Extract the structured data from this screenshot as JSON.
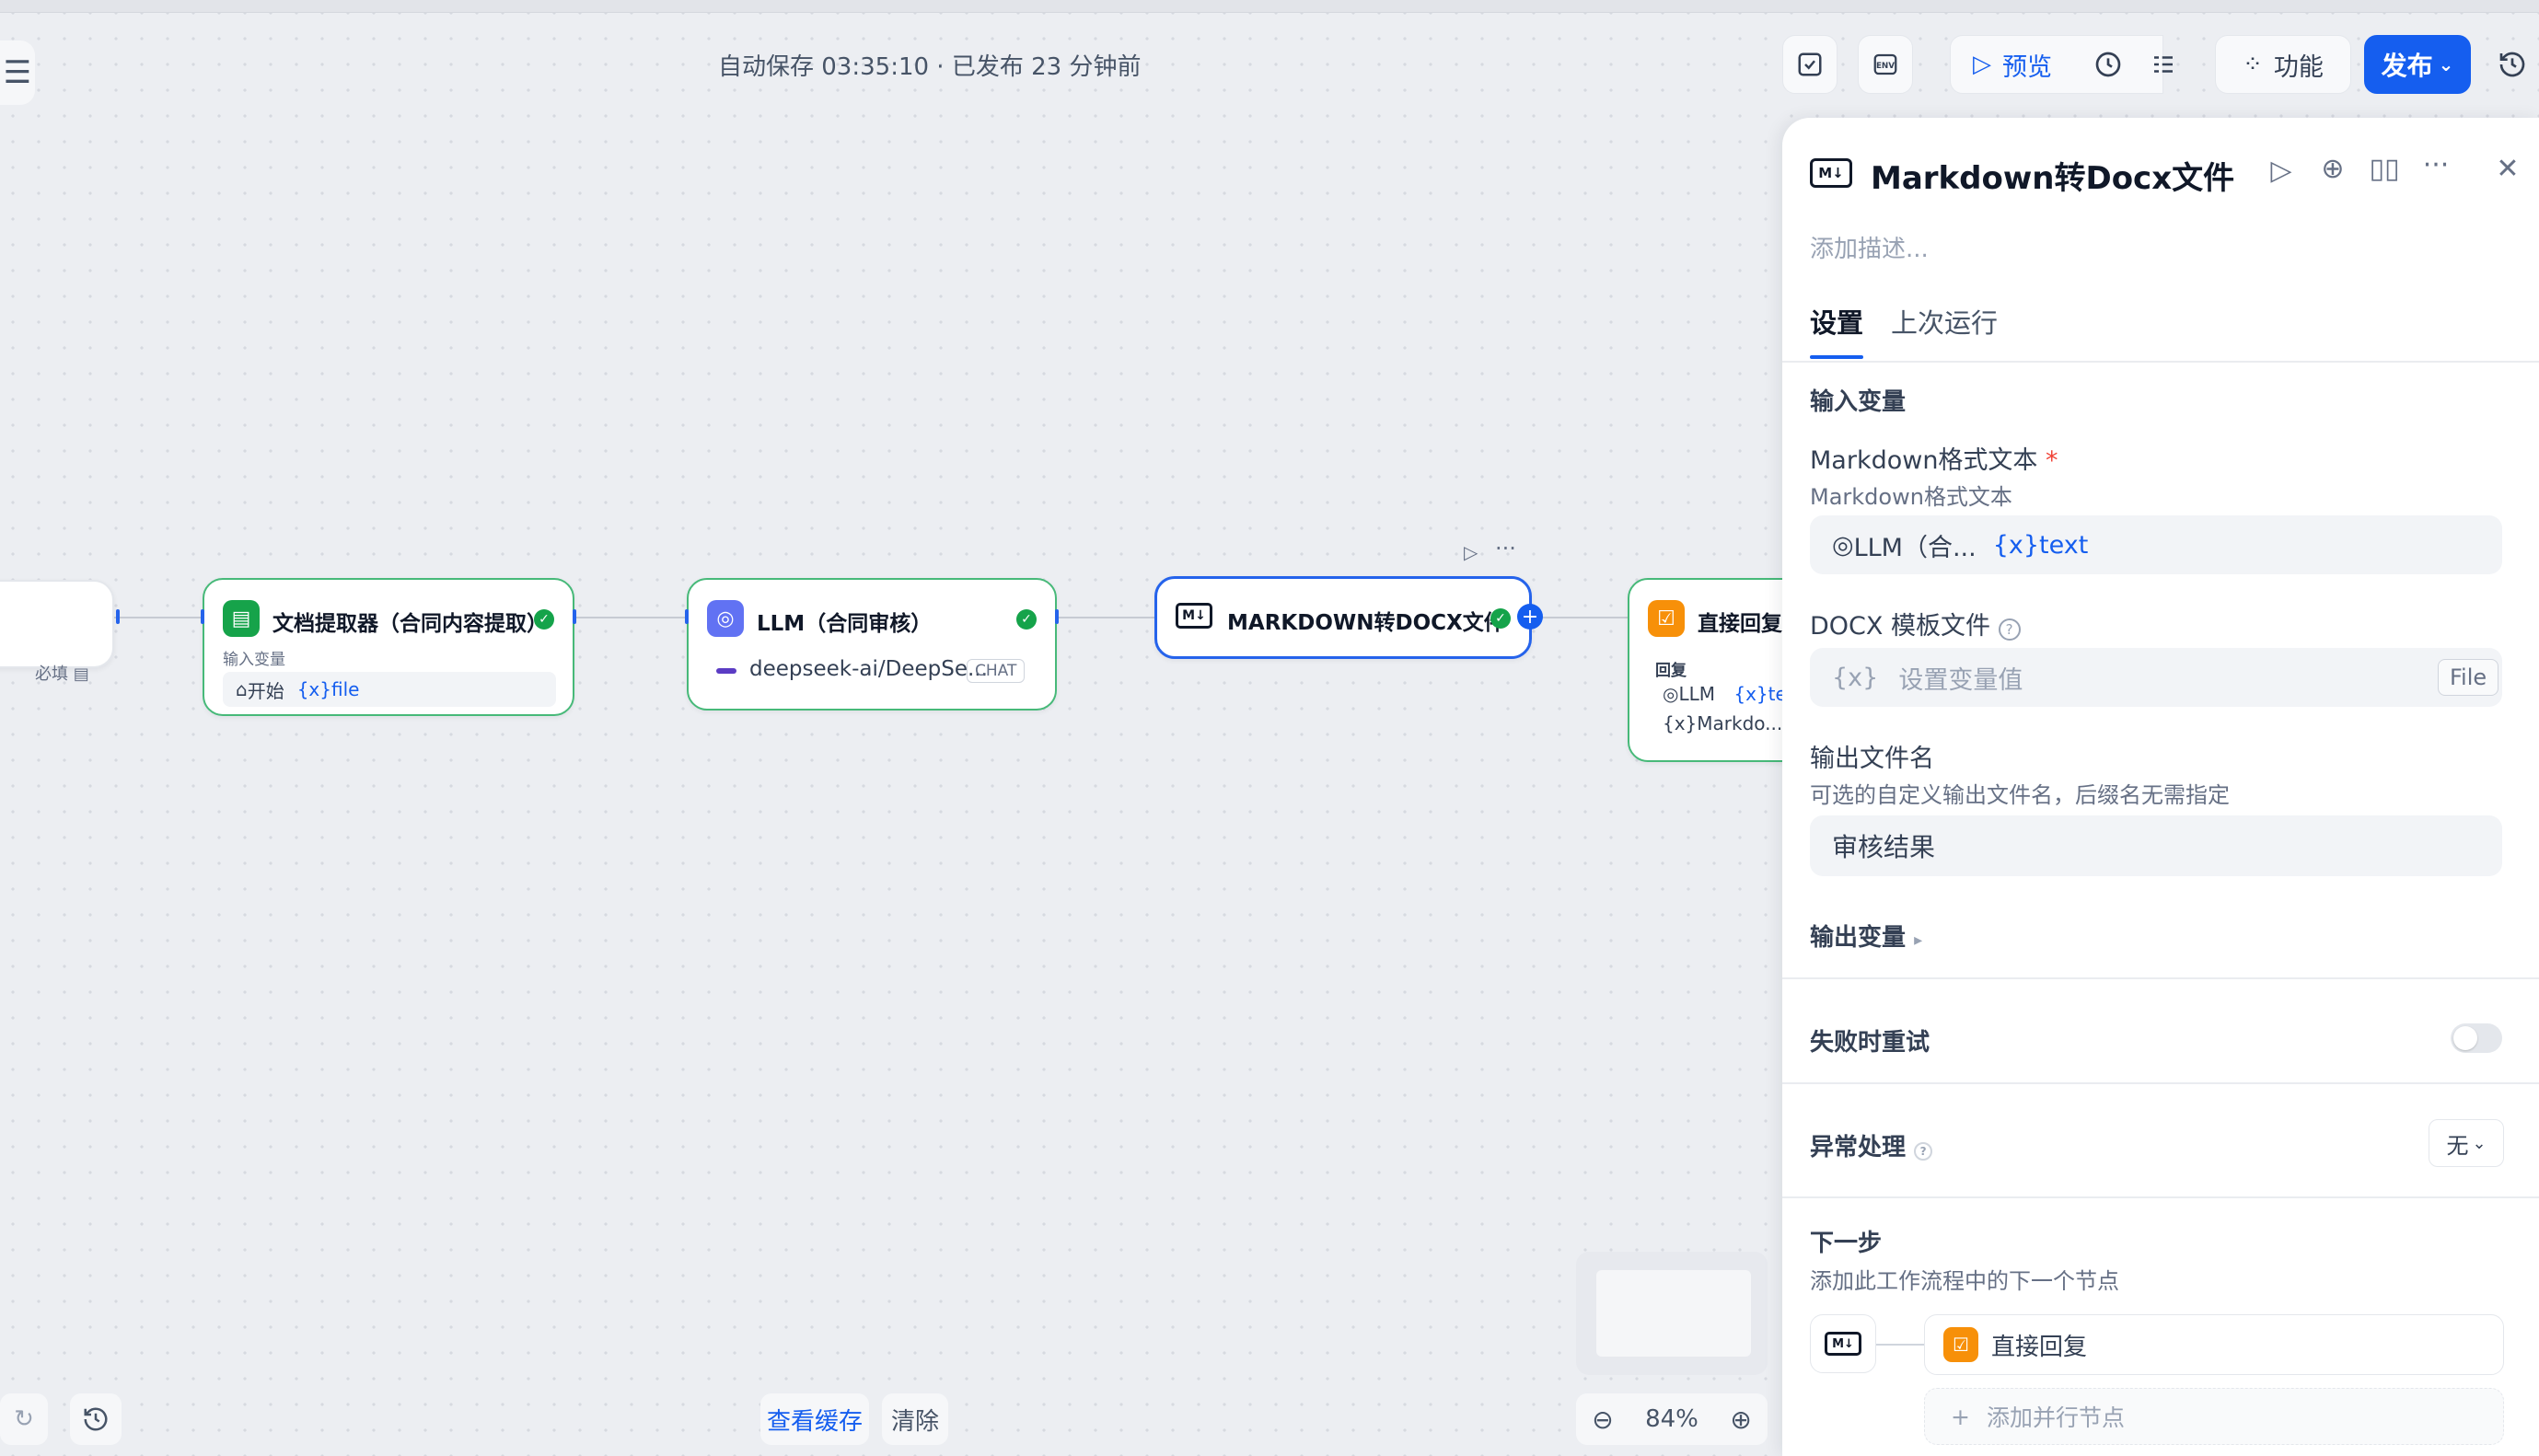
{
  "header": {
    "autosave": "自动保存 03:35:10 · 已发布 23 分钟前",
    "preview": "预览",
    "features": "功能",
    "publish": "发布"
  },
  "nodes": {
    "left_partial": {
      "required": "必填"
    },
    "doc_extractor": {
      "title": "文档提取器（合同内容提取）",
      "input_label": "输入变量",
      "chip_src": "开始",
      "chip_var": "{x}file"
    },
    "llm": {
      "title": "LLM（合同审核）",
      "model": "deepseek-ai/DeepSe...",
      "mode": "CHAT"
    },
    "md_docx": {
      "title": "MARKDOWN转DOCX文件"
    },
    "reply": {
      "title": "直接回复",
      "label": "回复",
      "line1_src": "LLM",
      "line1_var": "{x}tex",
      "line2": "{x}Markdo..."
    }
  },
  "bottom": {
    "view_cache": "查看缓存",
    "clear": "清除",
    "zoom": "84%"
  },
  "panel": {
    "title": "Markdown转Docx文件",
    "desc_placeholder": "添加描述...",
    "tabs": [
      "设置",
      "上次运行"
    ],
    "input_section": "输入变量",
    "md_label": "Markdown格式文本",
    "md_required": "*",
    "md_sub": "Markdown格式文本",
    "md_src": "LLM（合...",
    "md_var": "{x}text",
    "docx_label": "DOCX 模板文件",
    "docx_placeholder": "设置变量值",
    "docx_badge": "File",
    "out_name_label": "输出文件名",
    "out_name_sub": "可选的自定义输出文件名，后缀名无需指定",
    "out_name_value": "审核结果",
    "output_section": "输出变量",
    "retry_label": "失败时重试",
    "error_label": "异常处理",
    "error_value": "无",
    "next_label": "下一步",
    "next_sub": "添加此工作流程中的下一个节点",
    "next_node": "直接回复",
    "add_parallel": "添加并行节点"
  },
  "colors": {
    "accent": "#155eef",
    "success": "#15a34a",
    "orange": "#f79009",
    "indigo": "#6172f3"
  }
}
